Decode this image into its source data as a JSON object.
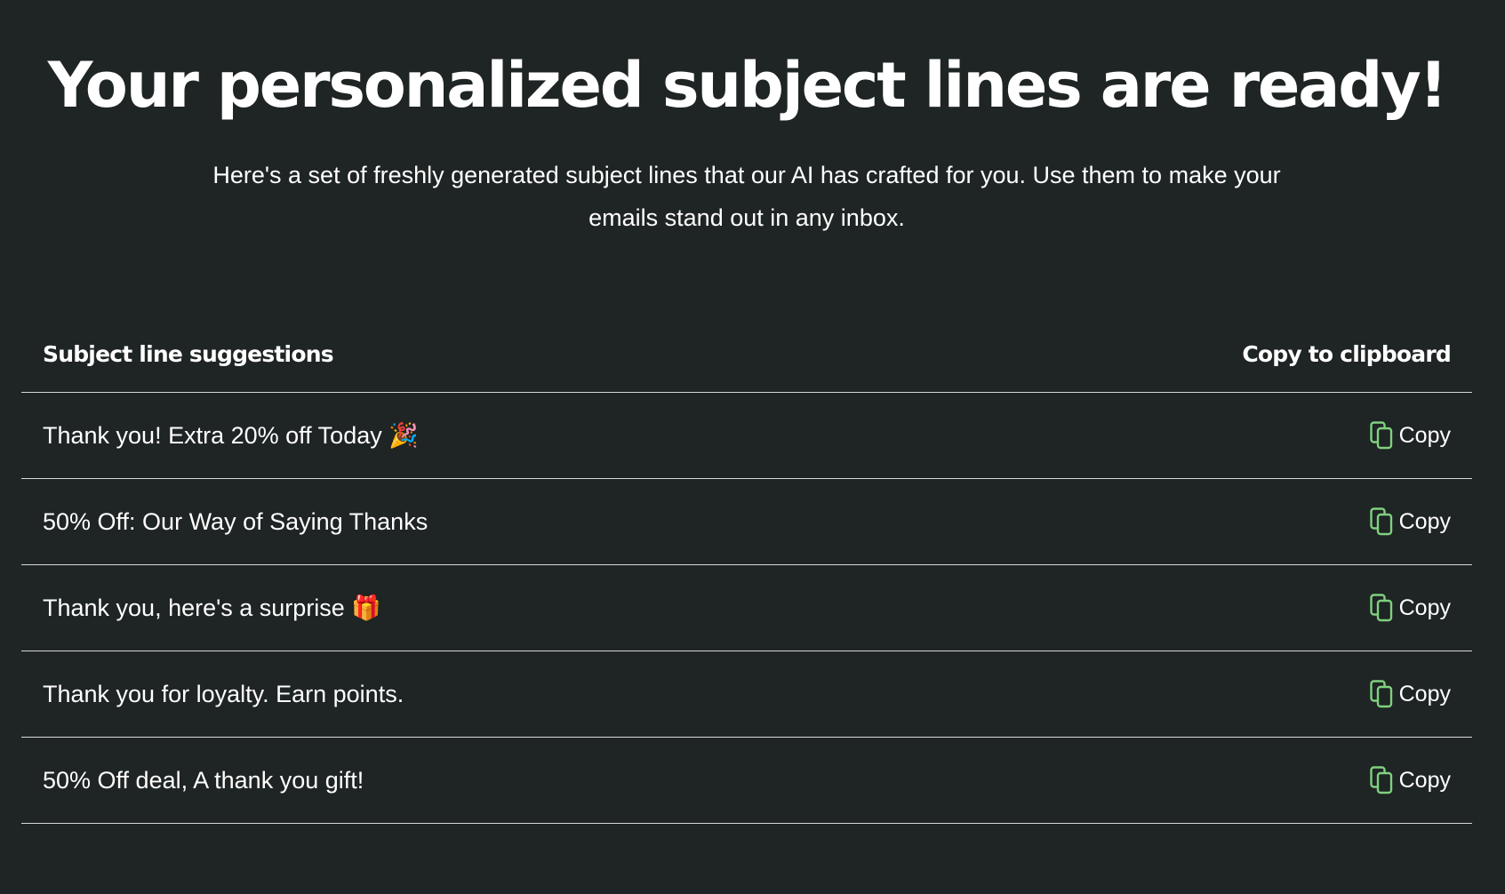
{
  "hero": {
    "title": "Your personalized subject lines are ready!",
    "subtitle": "Here's a set of freshly generated subject lines that our AI has crafted for you. Use them to make your emails stand out in any inbox."
  },
  "table": {
    "header_suggestions": "Subject line suggestions",
    "header_copy": "Copy to clipboard",
    "copy_label": "Copy",
    "rows": [
      {
        "subject": "Thank you! Extra 20% off Today 🎉"
      },
      {
        "subject": "50% Off: Our Way of Saying Thanks"
      },
      {
        "subject": "Thank you, here's a surprise 🎁"
      },
      {
        "subject": "Thank you for loyalty. Earn points."
      },
      {
        "subject": "50% Off deal, A thank you gift!"
      }
    ]
  },
  "colors": {
    "background": "#1f2424",
    "text": "#ffffff",
    "accent": "#7fd17f",
    "divider": "#d6d9d9"
  },
  "icons": {
    "copy": "copy-icon"
  }
}
